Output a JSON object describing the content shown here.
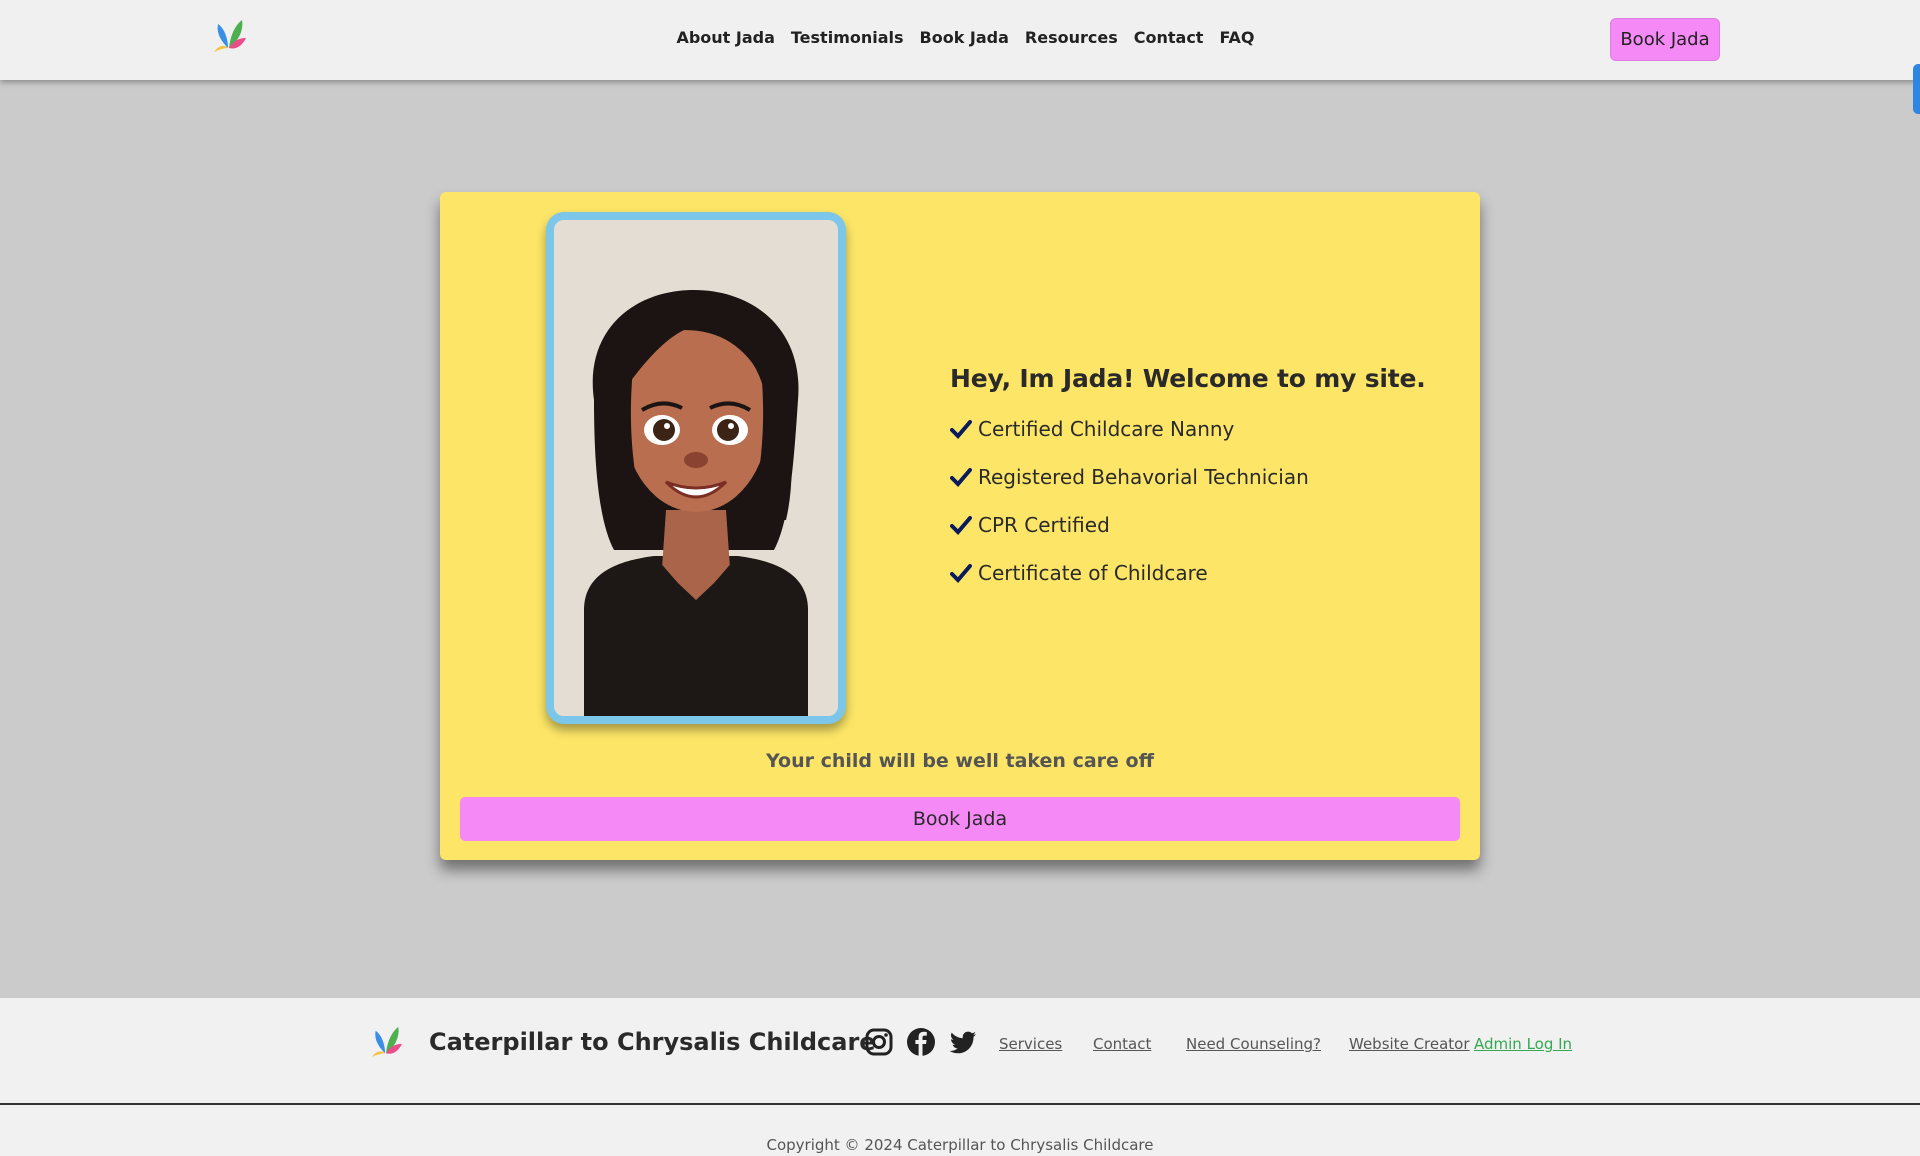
{
  "nav": {
    "logo_icon": "butterfly-logo-icon",
    "links": [
      "About Jada",
      "Testimonials",
      "Book Jada",
      "Resources",
      "Contact",
      "FAQ"
    ],
    "book_button": "Book Jada"
  },
  "hero": {
    "portrait_icon": "jada-cartoon-portrait",
    "heading": "Hey, Im Jada! Welcome to my site.",
    "credentials": [
      "Certified Childcare Nanny",
      "Registered Behavorial Technician",
      "CPR Certified",
      "Certificate of Childcare"
    ],
    "check_icon": "check-icon",
    "tagline": "Your child will be well taken care off",
    "book_button": "Book Jada"
  },
  "footer": {
    "brand": "Caterpillar to Chrysalis Childcare",
    "social_icons": [
      "instagram-icon",
      "facebook-icon",
      "twitter-icon"
    ],
    "links": [
      "Services",
      "Contact",
      "Need Counseling?",
      "Website Creator"
    ],
    "admin_link": "Admin Log In",
    "copyright": "Copyright © 2024 Caterpillar to Chrysalis Childcare"
  },
  "colors": {
    "page_bg": "#cbcbcb",
    "card_bg": "#fde667",
    "accent_pink": "#f589f5",
    "portrait_border": "#7cc6ea",
    "admin_green": "#34a853"
  }
}
